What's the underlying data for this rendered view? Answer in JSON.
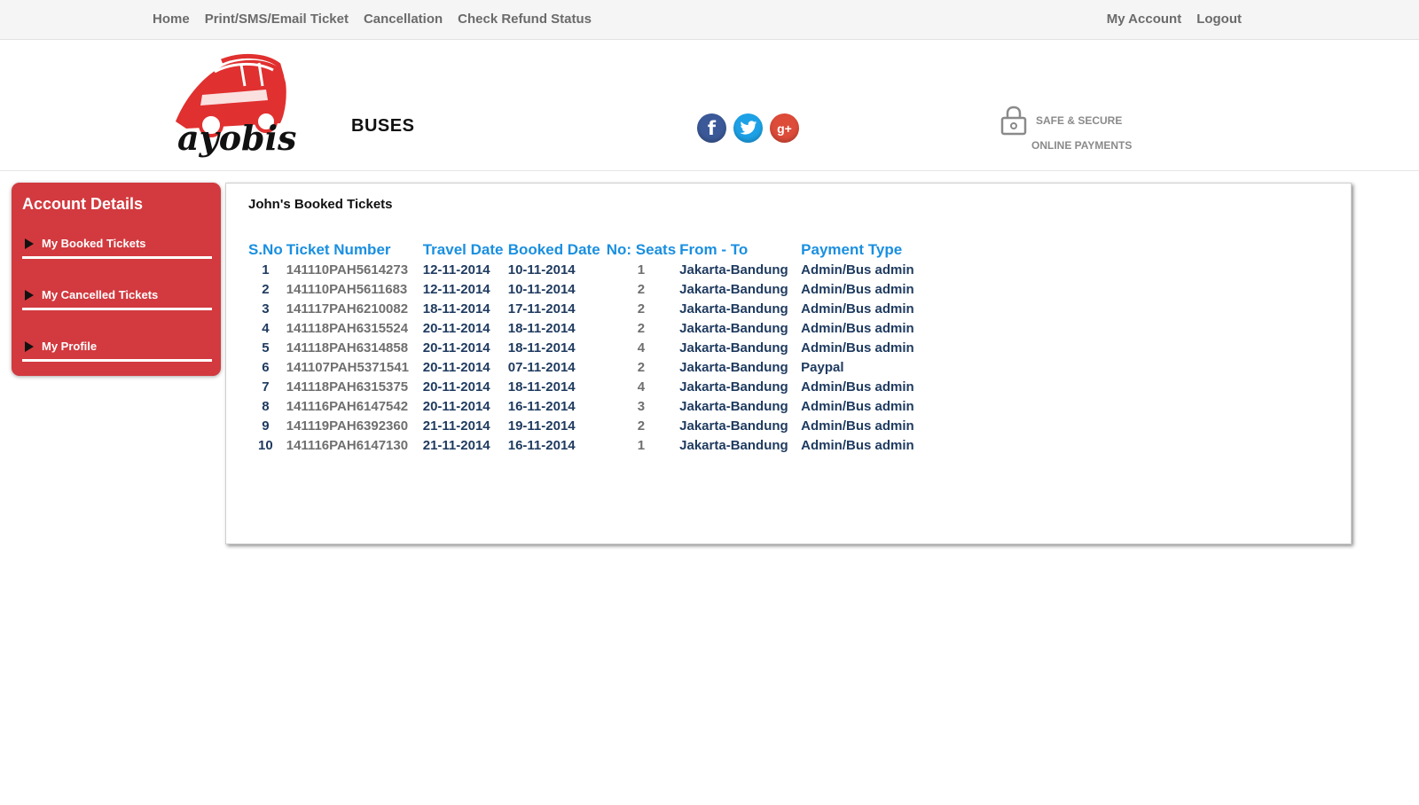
{
  "topnav": {
    "left": [
      "Home",
      "Print/SMS/Email Ticket",
      "Cancellation",
      "Check Refund Status"
    ],
    "right": [
      "My Account",
      "Logout"
    ]
  },
  "header": {
    "logo_text": "ayobis",
    "brand_label": "BUSES",
    "social": [
      "facebook-icon",
      "twitter-icon",
      "google-plus-icon"
    ],
    "social_glyphs": {
      "facebook": "f",
      "google_plus": "g+"
    },
    "secure_line1": "SAFE & SECURE",
    "secure_line2": "ONLINE PAYMENTS"
  },
  "sidebar": {
    "title": "Account Details",
    "items": [
      "My Booked Tickets",
      "My Cancelled Tickets",
      "My Profile"
    ]
  },
  "panel": {
    "title": "John's Booked Tickets",
    "columns": [
      "S.No",
      "Ticket Number",
      "Travel Date",
      "Booked Date",
      "No: Seats",
      "From - To",
      "Payment Type"
    ],
    "rows": [
      [
        "1",
        "141110PAH5614273",
        "12-11-2014",
        "10-11-2014",
        "1",
        "Jakarta-Bandung",
        "Admin/Bus admin"
      ],
      [
        "2",
        "141110PAH5611683",
        "12-11-2014",
        "10-11-2014",
        "2",
        "Jakarta-Bandung",
        "Admin/Bus admin"
      ],
      [
        "3",
        "141117PAH6210082",
        "18-11-2014",
        "17-11-2014",
        "2",
        "Jakarta-Bandung",
        "Admin/Bus admin"
      ],
      [
        "4",
        "141118PAH6315524",
        "20-11-2014",
        "18-11-2014",
        "2",
        "Jakarta-Bandung",
        "Admin/Bus admin"
      ],
      [
        "5",
        "141118PAH6314858",
        "20-11-2014",
        "18-11-2014",
        "4",
        "Jakarta-Bandung",
        "Admin/Bus admin"
      ],
      [
        "6",
        "141107PAH5371541",
        "20-11-2014",
        "07-11-2014",
        "2",
        "Jakarta-Bandung",
        "Paypal"
      ],
      [
        "7",
        "141118PAH6315375",
        "20-11-2014",
        "18-11-2014",
        "4",
        "Jakarta-Bandung",
        "Admin/Bus admin"
      ],
      [
        "8",
        "141116PAH6147542",
        "20-11-2014",
        "16-11-2014",
        "3",
        "Jakarta-Bandung",
        "Admin/Bus admin"
      ],
      [
        "9",
        "141119PAH6392360",
        "21-11-2014",
        "19-11-2014",
        "2",
        "Jakarta-Bandung",
        "Admin/Bus admin"
      ],
      [
        "10",
        "141116PAH6147130",
        "21-11-2014",
        "16-11-2014",
        "1",
        "Jakarta-Bandung",
        "Admin/Bus admin"
      ]
    ]
  },
  "colors": {
    "sidebar_bg": "#d23a3f",
    "header_blue": "#1a8fe0",
    "text_navy": "#1e3a5f",
    "text_gray": "#6f6f6f",
    "logo_red": "#e0302f"
  }
}
